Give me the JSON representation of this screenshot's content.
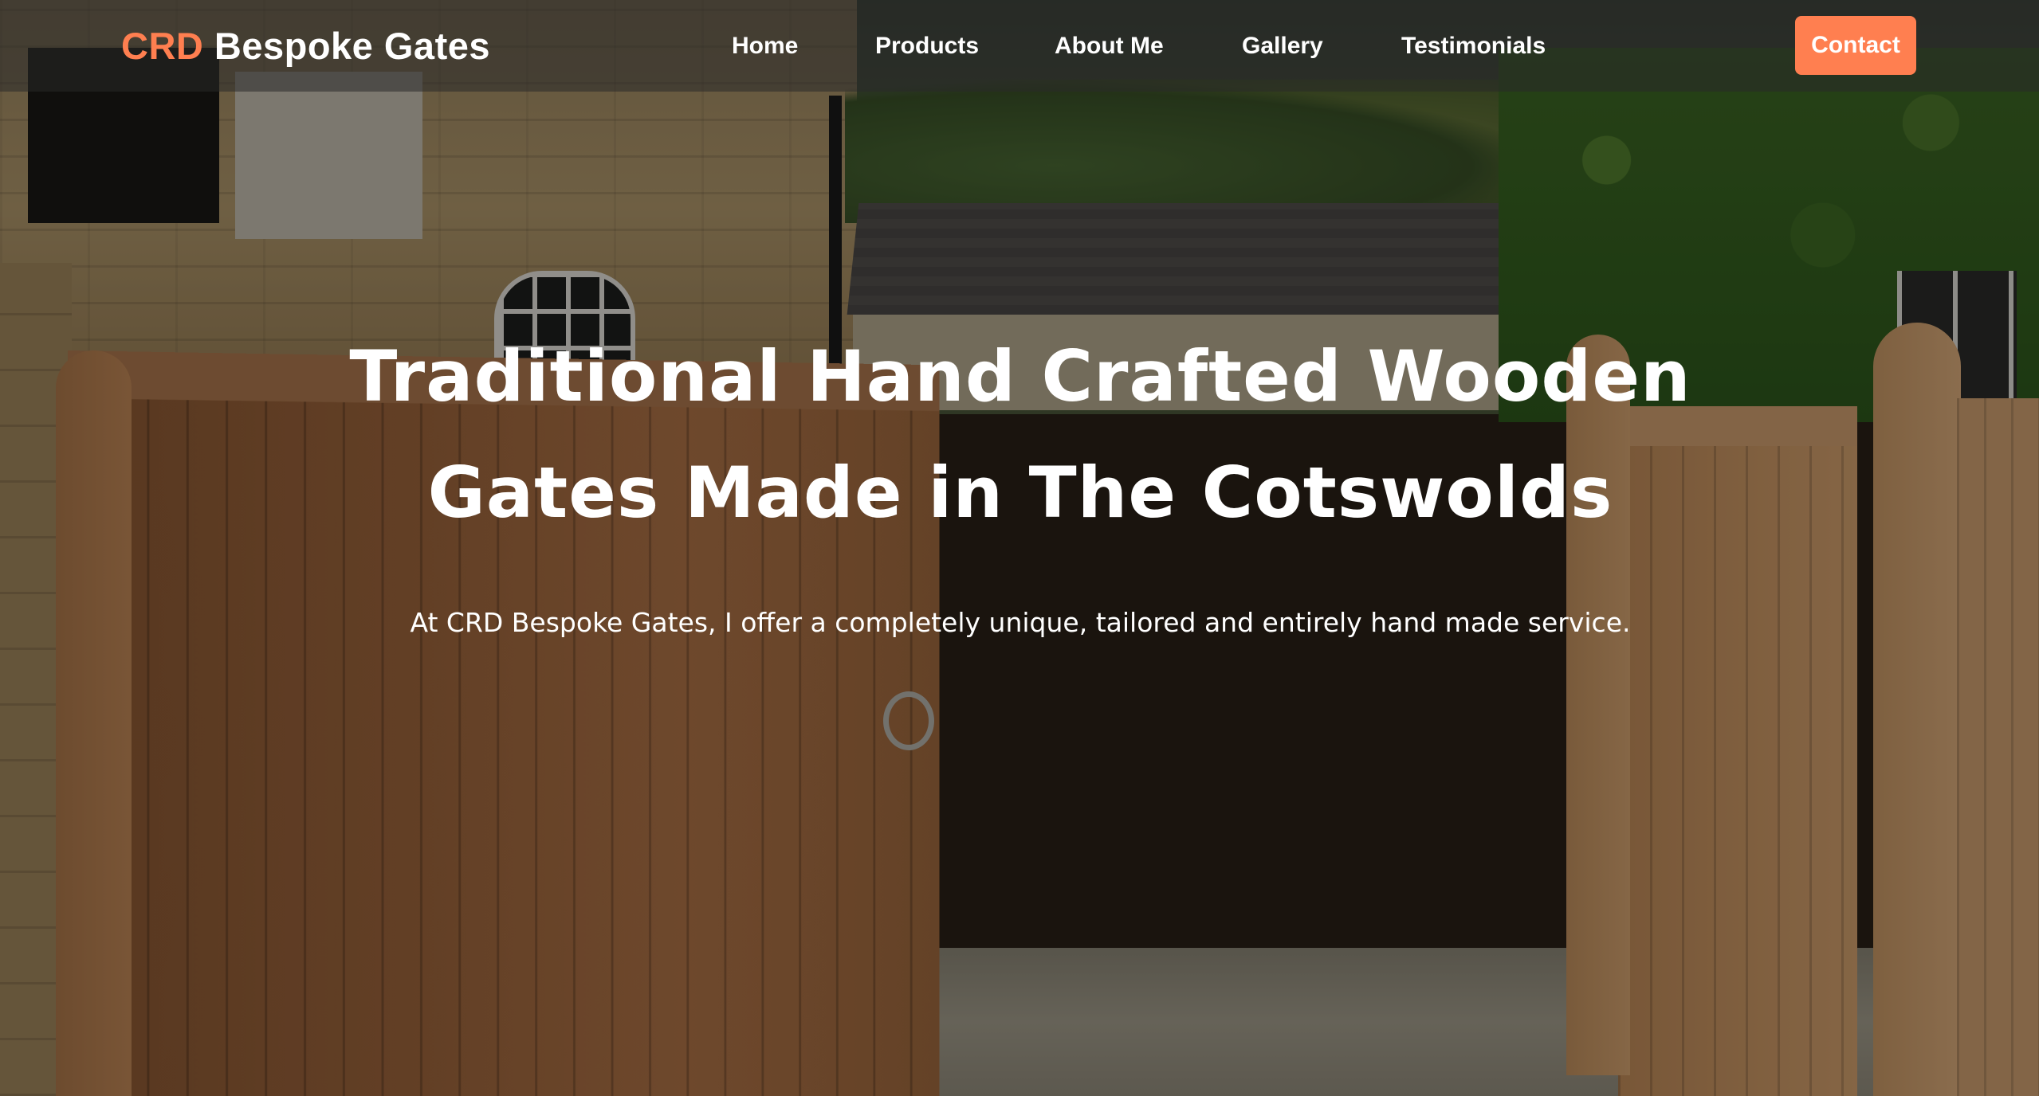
{
  "brand": {
    "accent": "CRD",
    "rest": "Bespoke Gates"
  },
  "nav": {
    "home": "Home",
    "products": "Products",
    "about": "About Me",
    "gallery": "Gallery",
    "testimonials": "Testimonials",
    "contact": "Contact"
  },
  "hero": {
    "title_line1": "Traditional Hand Crafted Wooden",
    "title_line2": "Gates Made in The Cotswolds",
    "subtitle": "At CRD Bespoke Gates, I offer a completely unique, tailored and entirely hand made service."
  },
  "colors": {
    "accent": "#ff7f50",
    "text": "#ffffff",
    "nav_background": "rgba(40,40,40,0.55)"
  }
}
